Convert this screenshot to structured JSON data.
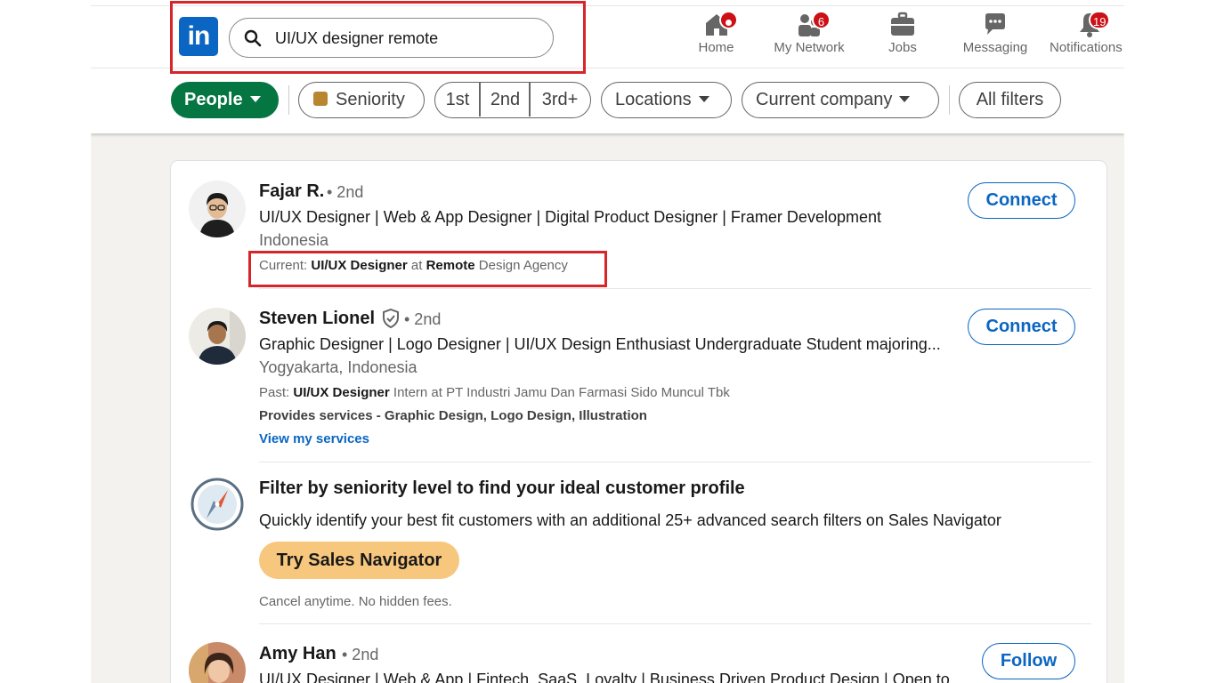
{
  "header": {
    "logo_text": "in",
    "search": {
      "value": "UI/UX designer remote"
    },
    "nav": [
      {
        "label": "Home",
        "icon": "home-icon",
        "badge": ""
      },
      {
        "label": "My Network",
        "icon": "network-icon",
        "badge": "6"
      },
      {
        "label": "Jobs",
        "icon": "briefcase-icon",
        "badge": ""
      },
      {
        "label": "Messaging",
        "icon": "messaging-icon",
        "badge": ""
      },
      {
        "label": "Notifications",
        "icon": "bell-icon",
        "badge": "19"
      }
    ]
  },
  "filters": {
    "people": "People",
    "seniority": "Seniority",
    "degree_1": "1st",
    "degree_2": "2nd",
    "degree_3": "3rd+",
    "locations": "Locations",
    "current_company": "Current company",
    "all_filters": "All filters"
  },
  "results": [
    {
      "name": "Fajar R.",
      "degree": "• 2nd",
      "headline": "UI/UX Designer | Web & App Designer | Digital Product Designer | Framer Development",
      "location": "Indonesia",
      "current_prefix": "Current:",
      "current_role": "UI/UX Designer",
      "current_at": "at",
      "current_company_bold": "Remote",
      "current_company_rest": "Design Agency",
      "action": "Connect"
    },
    {
      "name": "Steven Lionel",
      "degree": "• 2nd",
      "headline": "Graphic Designer | Logo Designer | UI/UX Design Enthusiast Undergraduate Student majoring...",
      "location": "Yogyakarta, Indonesia",
      "past_prefix": "Past:",
      "past_role": "UI/UX Designer",
      "past_rest": "Intern at PT Industri Jamu Dan Farmasi Sido Muncul Tbk",
      "services": "Provides services - Graphic Design, Logo Design, Illustration",
      "services_link": "View my services",
      "action": "Connect"
    },
    {
      "name": "Amy Han",
      "degree": "• 2nd",
      "headline": "UI/UX Designer | Web & App | Fintech, SaaS, Loyalty | Business Driven Product Design | Open to",
      "action": "Follow"
    }
  ],
  "promo": {
    "title": "Filter by seniority level to find your ideal customer profile",
    "description": "Quickly identify your best fit customers with an additional 25+ advanced search filters on Sales Navigator",
    "button": "Try Sales Navigator",
    "note": "Cancel anytime. No hidden fees."
  },
  "colors": {
    "brand": "#0a66c2",
    "people_pill": "#057642",
    "highlight_box": "#d6262a",
    "promo_button": "#f8c77e",
    "badge": "#cc1016"
  }
}
